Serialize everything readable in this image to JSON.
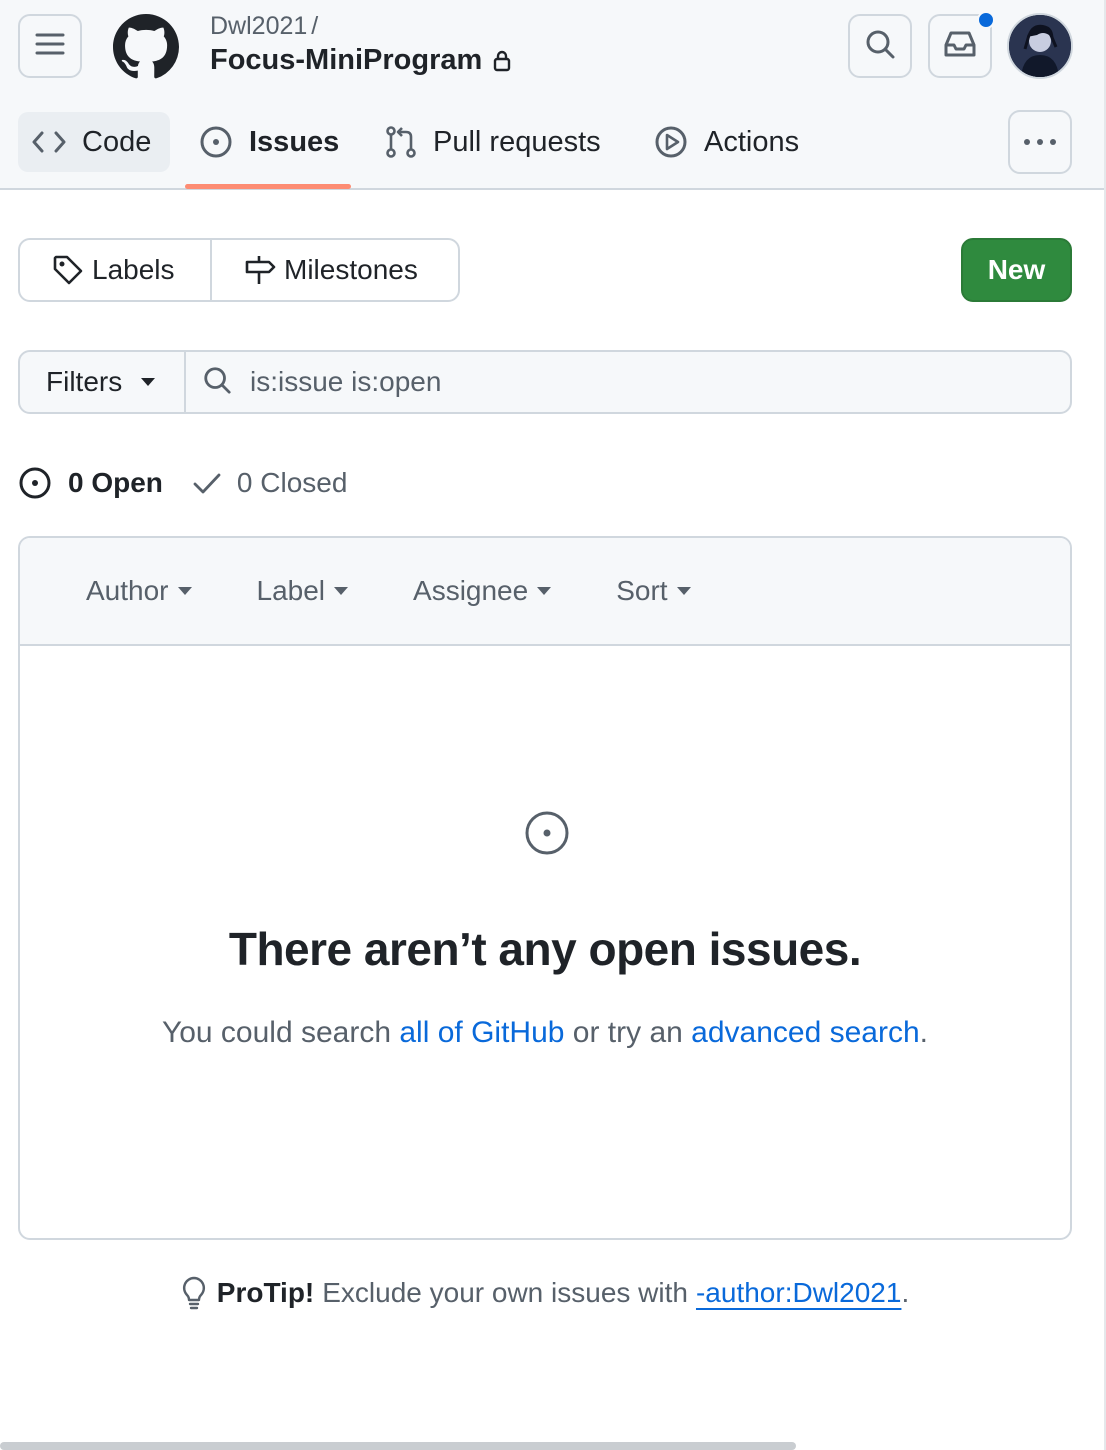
{
  "header": {
    "owner": "Dwl2021",
    "owner_separator": "/",
    "repo_name": "Focus-MiniProgram",
    "menu_icon": "hamburger-icon",
    "logo_icon": "github-mark-icon",
    "search_icon": "search-icon",
    "inbox_icon": "inbox-icon",
    "lock_icon": "lock-icon",
    "notification_dot_color": "#0969da"
  },
  "tabs": [
    {
      "label": "Code",
      "icon": "code-icon"
    },
    {
      "label": "Issues",
      "icon": "issue-opened-icon",
      "selected": true
    },
    {
      "label": "Pull requests",
      "icon": "git-pull-request-icon"
    },
    {
      "label": "Actions",
      "icon": "play-icon"
    }
  ],
  "toolbar": {
    "labels_label": "Labels",
    "milestones_label": "Milestones",
    "new_label": "New",
    "new_color": "#2f8a3e"
  },
  "filter_bar": {
    "filters_label": "Filters",
    "search_value": "is:issue is:open"
  },
  "counts": {
    "open_label": "0 Open",
    "closed_label": "0 Closed"
  },
  "list_header": {
    "author": "Author",
    "label": "Label",
    "assignee": "Assignee",
    "sort": "Sort"
  },
  "blankslate": {
    "title": "There aren’t any open issues.",
    "text_before": "You could search ",
    "link1": "all of GitHub",
    "text_middle": " or try an ",
    "link2": "advanced search",
    "text_after": "."
  },
  "protip": {
    "strong": "ProTip!",
    "text": "Exclude your own issues with",
    "link": "-author:Dwl2021",
    "after": "."
  },
  "colors": {
    "accent_link": "#0969da",
    "tab_underline": "#fd8c73"
  }
}
